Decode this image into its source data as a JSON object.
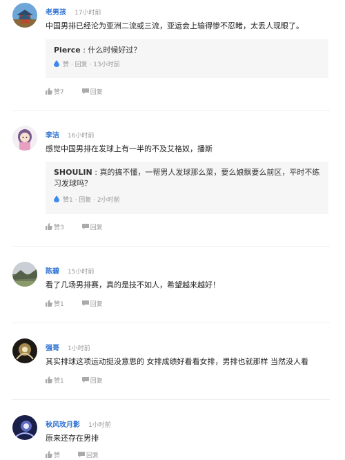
{
  "reply_prefix": " : ",
  "colors": {
    "username": "#2a6fd1",
    "muted": "#999999",
    "reply_bg": "#f6f6f6",
    "drop": "#3b8beb"
  },
  "comments": [
    {
      "username": "老男孩",
      "time": "17小时前",
      "text": "中国男排已经沦为亚洲二流或三流，亚运会上输得惨不忍睹，太丢人现眼了。",
      "avatar_icon": "temple-avatar-icon",
      "reply": {
        "user": "Pierce",
        "text": "什么时候好过？",
        "meta": "赞 · 回复 · 13小时前"
      },
      "like_label": "赞7",
      "reply_label": "回复"
    },
    {
      "username": "李洁",
      "time": "16小时前",
      "text": "感觉中国男排在发球上有一半的不及艾格奴，播斯",
      "avatar_icon": "cartoon-girl-avatar-icon",
      "reply": {
        "user": "SHOULIN",
        "text": "真的搞不懂，一帮男人发球那么菜，要么娘飘要么前区，平时不练习发球吗？",
        "meta": "赞1 · 回复 · 2小时前"
      },
      "like_label": "赞3",
      "reply_label": "回复"
    },
    {
      "username": "陈碧",
      "time": "15小时前",
      "text": "看了几场男排赛，真的是技不如人，希望越来越好！",
      "avatar_icon": "landscape-avatar-icon",
      "like_label": "赞1",
      "reply_label": "回复"
    },
    {
      "username": "强哥",
      "time": "1小时前",
      "text": "其实排球这项运动挺没意思的 女排成绩好看看女排，男排也就那样 当然没人看",
      "avatar_icon": "dark-art-avatar-icon",
      "like_label": "赞1",
      "reply_label": "回复"
    },
    {
      "username": "秋风玫月影",
      "time": "1小时前",
      "text": "原来还存在男排",
      "avatar_icon": "anime-avatar-icon",
      "like_label": "赞",
      "reply_label": "回复"
    }
  ]
}
